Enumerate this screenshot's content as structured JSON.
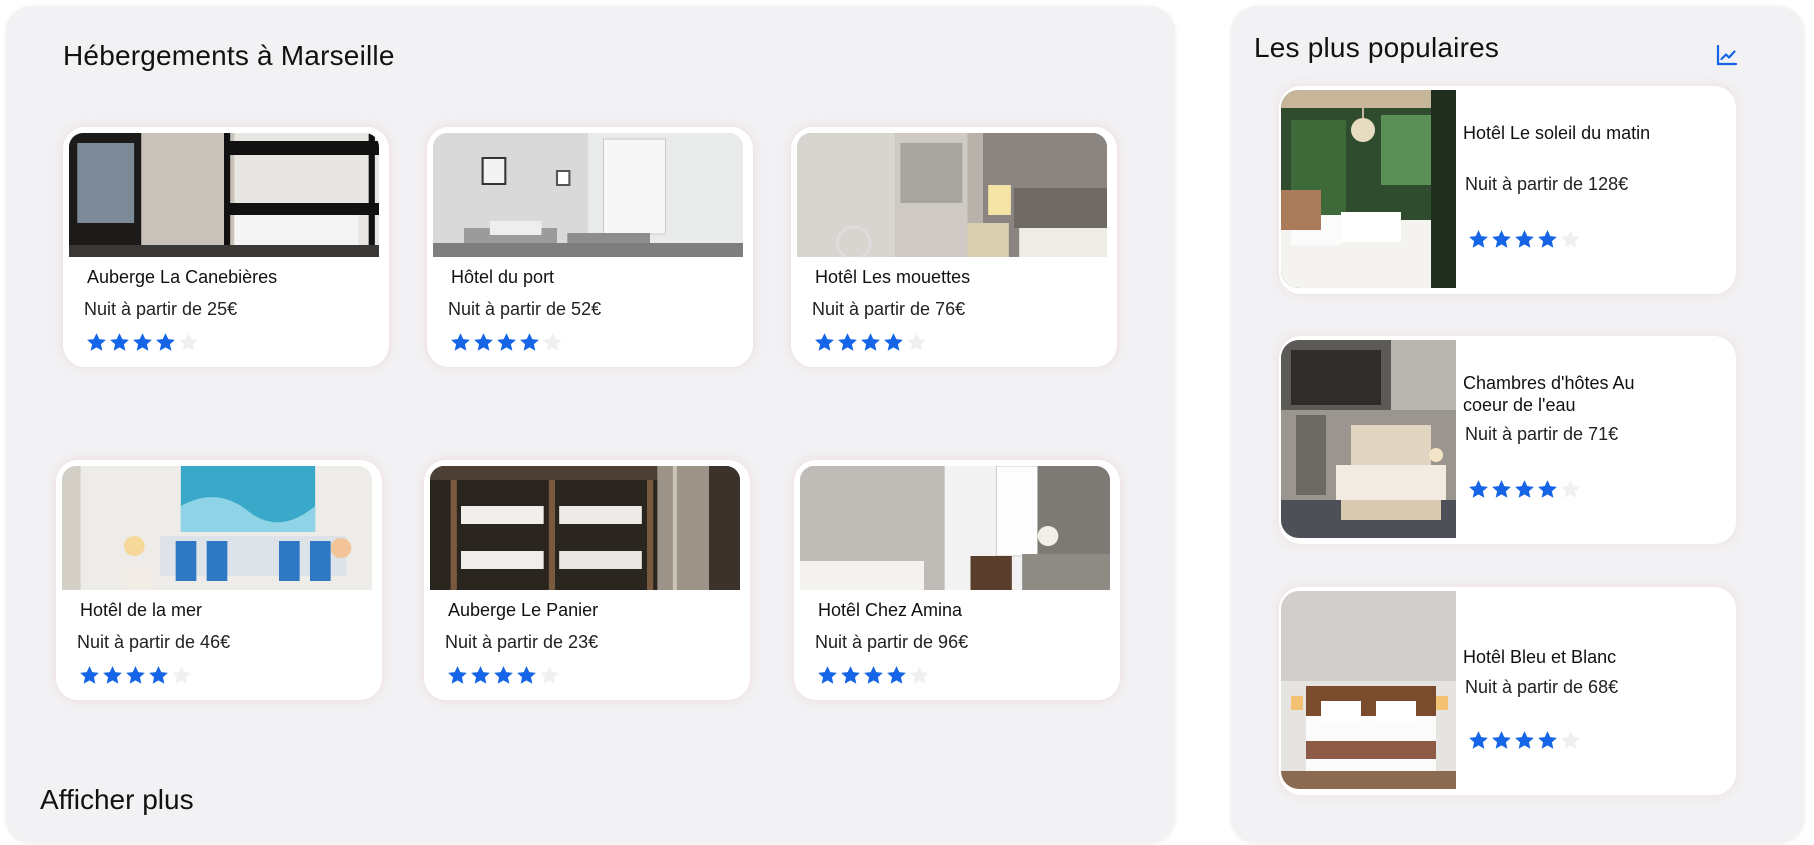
{
  "colors": {
    "accent": "#1565e6",
    "panel_bg": "#f2f1f3",
    "card_bg": "#ffffff",
    "star_empty": "#f0f0f2"
  },
  "listing": {
    "title": "Hébergements à Marseille",
    "show_more_label": "Afficher plus",
    "cards": [
      {
        "name": "Auberge La Canebières",
        "price": "Nuit à partir de 25€",
        "rating": 4,
        "max_rating": 5
      },
      {
        "name": "Hôtel du port",
        "price": "Nuit à partir de 52€",
        "rating": 4,
        "max_rating": 5
      },
      {
        "name": "Hotêl Les mouettes",
        "price": "Nuit à partir de 76€",
        "rating": 4,
        "max_rating": 5
      },
      {
        "name": "Hotêl de la mer",
        "price": "Nuit à partir de 46€",
        "rating": 4,
        "max_rating": 5
      },
      {
        "name": "Auberge Le Panier",
        "price": "Nuit à partir de 23€",
        "rating": 4,
        "max_rating": 5
      },
      {
        "name": "Hotêl Chez Amina",
        "price": "Nuit à partir de 96€",
        "rating": 4,
        "max_rating": 5
      }
    ]
  },
  "popular": {
    "title": "Les plus populaires",
    "trend_icon": "trending-chart-icon",
    "cards": [
      {
        "name": "Hotêl Le soleil du matin",
        "price": "Nuit à partir de 128€",
        "rating": 4,
        "max_rating": 5
      },
      {
        "name": "Chambres d'hôtes Au coeur de l'eau",
        "price": "Nuit à partir de 71€",
        "rating": 4,
        "max_rating": 5
      },
      {
        "name": "Hotêl Bleu et Blanc",
        "price": "Nuit à partir de 68€",
        "rating": 4,
        "max_rating": 5
      }
    ]
  }
}
